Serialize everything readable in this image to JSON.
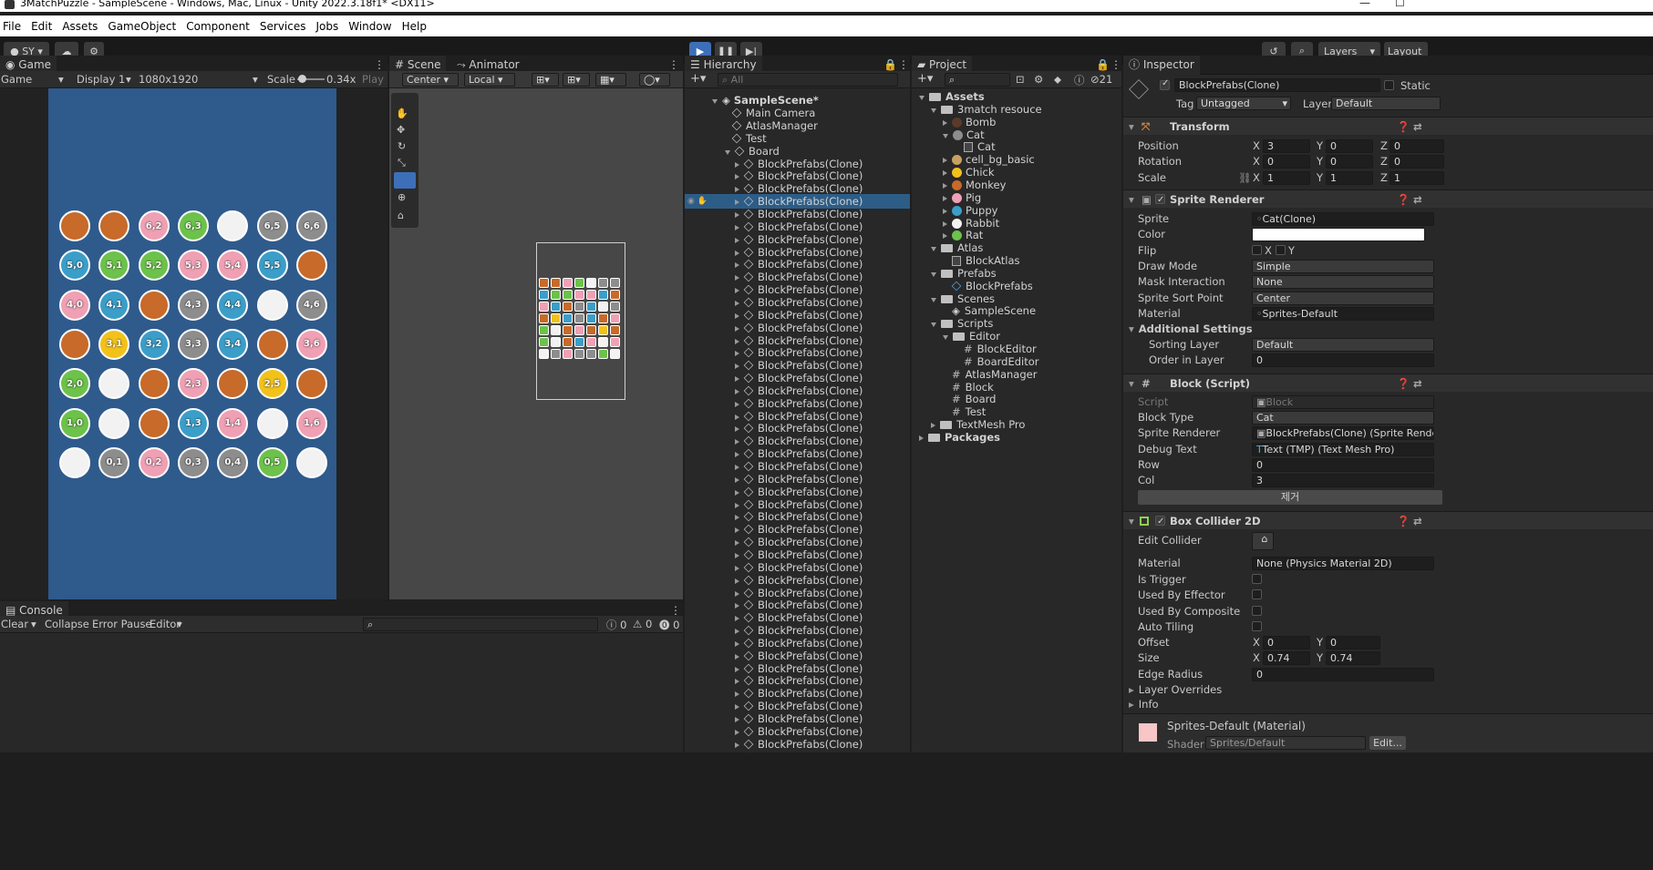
{
  "window": {
    "title": "3MatchPuzzle - SampleScene - Windows, Mac, Linux - Unity 2022.3.18f1* <DX11>"
  },
  "menu": [
    "File",
    "Edit",
    "Assets",
    "GameObject",
    "Component",
    "Services",
    "Jobs",
    "Window",
    "Help"
  ],
  "toolbar": {
    "account": "SY",
    "layers": "Layers",
    "layout": "Layout"
  },
  "game": {
    "tab": "Game",
    "mode": "Game",
    "display": "Display 1",
    "resolution": "1080x1920",
    "scale_label": "Scale",
    "scale_value": "0.34x",
    "play": "Play",
    "board": [
      [
        {
          "t": "monkey",
          "l": ""
        },
        {
          "t": "monkey",
          "l": ""
        },
        {
          "t": "pig",
          "l": "6,2"
        },
        {
          "t": "frog",
          "l": "6,3"
        },
        {
          "t": "rabbit",
          "l": ""
        },
        {
          "t": "cat",
          "l": "6,5"
        },
        {
          "t": "cat",
          "l": "6,6"
        }
      ],
      [
        {
          "t": "puppy",
          "l": "5,0"
        },
        {
          "t": "frog",
          "l": "5,1"
        },
        {
          "t": "frog",
          "l": "5,2"
        },
        {
          "t": "pig",
          "l": "5,3"
        },
        {
          "t": "pig",
          "l": "5,4"
        },
        {
          "t": "puppy",
          "l": "5,5"
        },
        {
          "t": "monkey",
          "l": ""
        }
      ],
      [
        {
          "t": "pig",
          "l": "4,0"
        },
        {
          "t": "puppy",
          "l": "4,1"
        },
        {
          "t": "monkey",
          "l": ""
        },
        {
          "t": "cat",
          "l": "4,3"
        },
        {
          "t": "puppy",
          "l": "4,4"
        },
        {
          "t": "rabbit",
          "l": ""
        },
        {
          "t": "cat",
          "l": "4,6"
        }
      ],
      [
        {
          "t": "monkey",
          "l": ""
        },
        {
          "t": "chick",
          "l": "3,1"
        },
        {
          "t": "puppy",
          "l": "3,2"
        },
        {
          "t": "cat",
          "l": "3,3"
        },
        {
          "t": "puppy",
          "l": "3,4"
        },
        {
          "t": "monkey",
          "l": ""
        },
        {
          "t": "pig",
          "l": "3,6"
        }
      ],
      [
        {
          "t": "frog",
          "l": "2,0"
        },
        {
          "t": "rabbit",
          "l": ""
        },
        {
          "t": "monkey",
          "l": ""
        },
        {
          "t": "pig",
          "l": "2,3"
        },
        {
          "t": "monkey",
          "l": ""
        },
        {
          "t": "chick",
          "l": "2,5"
        },
        {
          "t": "monkey",
          "l": ""
        }
      ],
      [
        {
          "t": "frog",
          "l": "1,0"
        },
        {
          "t": "rabbit",
          "l": ""
        },
        {
          "t": "monkey",
          "l": ""
        },
        {
          "t": "puppy",
          "l": "1,3"
        },
        {
          "t": "pig",
          "l": "1,4"
        },
        {
          "t": "rabbit",
          "l": ""
        },
        {
          "t": "pig",
          "l": "1,6"
        }
      ],
      [
        {
          "t": "rabbit",
          "l": ""
        },
        {
          "t": "cat",
          "l": "0,1"
        },
        {
          "t": "pig",
          "l": "0,2"
        },
        {
          "t": "cat",
          "l": "0,3"
        },
        {
          "t": "cat",
          "l": "0,4"
        },
        {
          "t": "frog",
          "l": "0,5"
        },
        {
          "t": "rabbit",
          "l": ""
        }
      ]
    ]
  },
  "tile_colors": {
    "monkey": "#c76a2a",
    "pig": "#f0a0b4",
    "frog": "#6cc24a",
    "rabbit": "#f2f2f2",
    "cat": "#8d8d8d",
    "puppy": "#3b9ec9",
    "chick": "#f2c21b"
  },
  "scene": {
    "tab": "Scene",
    "tab2": "Animator",
    "pivot": "Center",
    "space": "Local"
  },
  "hierarchy": {
    "tab": "Hierarchy",
    "search_placeholder": "All",
    "scene_name": "SampleScene*",
    "roots": [
      "Main Camera",
      "AtlasManager",
      "Test",
      "Board"
    ],
    "child": "BlockPrefabs(Clone)"
  },
  "project": {
    "tab": "Project",
    "count": "21",
    "tree": [
      {
        "d": 0,
        "n": "Assets",
        "k": "folder",
        "o": true
      },
      {
        "d": 1,
        "n": "3match resouce",
        "k": "folder",
        "o": true
      },
      {
        "d": 2,
        "n": "Bomb",
        "k": "bomb",
        "o": false
      },
      {
        "d": 2,
        "n": "Cat",
        "k": "cat",
        "o": true
      },
      {
        "d": 3,
        "n": "Cat",
        "k": "sprite"
      },
      {
        "d": 2,
        "n": "cell_bg_basic",
        "k": "cellbg",
        "o": false
      },
      {
        "d": 2,
        "n": "Chick",
        "k": "chick",
        "o": false
      },
      {
        "d": 2,
        "n": "Monkey",
        "k": "monkey",
        "o": false
      },
      {
        "d": 2,
        "n": "Pig",
        "k": "pig",
        "o": false
      },
      {
        "d": 2,
        "n": "Puppy",
        "k": "puppy",
        "o": false
      },
      {
        "d": 2,
        "n": "Rabbit",
        "k": "rabbit",
        "o": false
      },
      {
        "d": 2,
        "n": "Rat",
        "k": "frog",
        "o": false
      },
      {
        "d": 1,
        "n": "Atlas",
        "k": "folder",
        "o": true
      },
      {
        "d": 2,
        "n": "BlockAtlas",
        "k": "atlas"
      },
      {
        "d": 1,
        "n": "Prefabs",
        "k": "folder",
        "o": true
      },
      {
        "d": 2,
        "n": "BlockPrefabs",
        "k": "prefab"
      },
      {
        "d": 1,
        "n": "Scenes",
        "k": "folder",
        "o": true
      },
      {
        "d": 2,
        "n": "SampleScene",
        "k": "unity"
      },
      {
        "d": 1,
        "n": "Scripts",
        "k": "folder",
        "o": true
      },
      {
        "d": 2,
        "n": "Editor",
        "k": "folder",
        "o": true
      },
      {
        "d": 3,
        "n": "BlockEditor",
        "k": "script"
      },
      {
        "d": 3,
        "n": "BoardEditor",
        "k": "script"
      },
      {
        "d": 2,
        "n": "AtlasManager",
        "k": "script"
      },
      {
        "d": 2,
        "n": "Block",
        "k": "script"
      },
      {
        "d": 2,
        "n": "Board",
        "k": "script"
      },
      {
        "d": 2,
        "n": "Test",
        "k": "script"
      },
      {
        "d": 1,
        "n": "TextMesh Pro",
        "k": "folder",
        "o": false
      },
      {
        "d": 0,
        "n": "Packages",
        "k": "folder",
        "o": false
      }
    ]
  },
  "inspector": {
    "tab": "Inspector",
    "name": "BlockPrefabs(Clone)",
    "static": "Static",
    "tag_label": "Tag",
    "tag": "Untagged",
    "layer_label": "Layer",
    "layer": "Default",
    "transform": {
      "title": "Transform",
      "position": {
        "label": "Position",
        "x": "3",
        "y": "0",
        "z": "0"
      },
      "rotation": {
        "label": "Rotation",
        "x": "0",
        "y": "0",
        "z": "0"
      },
      "scale": {
        "label": "Scale",
        "x": "1",
        "y": "1",
        "z": "1"
      }
    },
    "sprite_renderer": {
      "title": "Sprite Renderer",
      "rows": [
        {
          "l": "Sprite",
          "v": "Cat(Clone)"
        },
        {
          "l": "Color",
          "v": ""
        },
        {
          "l": "Flip",
          "v": ""
        },
        {
          "l": "Draw Mode",
          "v": "Simple"
        },
        {
          "l": "Mask Interaction",
          "v": "None"
        },
        {
          "l": "Sprite Sort Point",
          "v": "Center"
        },
        {
          "l": "Material",
          "v": "Sprites-Default"
        }
      ],
      "flip_x": "X",
      "flip_y": "Y",
      "additional": "Additional Settings",
      "sorting_layer": {
        "l": "Sorting Layer",
        "v": "Default"
      },
      "order": {
        "l": "Order in Layer",
        "v": "0"
      }
    },
    "block": {
      "title": "Block (Script)",
      "rows": [
        {
          "l": "Script",
          "v": "Block"
        },
        {
          "l": "Block Type",
          "v": "Cat"
        },
        {
          "l": "Sprite Renderer",
          "v": "BlockPrefabs(Clone) (Sprite Rendere"
        },
        {
          "l": "Debug Text",
          "v": "Text (TMP) (Text Mesh Pro)"
        },
        {
          "l": "Row",
          "v": "0"
        },
        {
          "l": "Col",
          "v": "3"
        }
      ],
      "button": "제거"
    },
    "box_collider": {
      "title": "Box Collider 2D",
      "edit": "Edit Collider",
      "material": {
        "l": "Material",
        "v": "None (Physics Material 2D)"
      },
      "checks": [
        "Is Trigger",
        "Used By Effector",
        "Used By Composite",
        "Auto Tiling"
      ],
      "offset": {
        "l": "Offset",
        "x": "0",
        "y": "0"
      },
      "size": {
        "l": "Size",
        "x": "0.74",
        "y": "0.74"
      },
      "edge": {
        "l": "Edge Radius",
        "v": "0"
      },
      "overrides": "Layer Overrides",
      "info": "Info"
    },
    "material": {
      "name": "Sprites-Default (Material)",
      "shader_label": "Shader",
      "shader": "Sprites/Default",
      "edit": "Edit..."
    }
  },
  "console": {
    "tab": "Console",
    "clear": "Clear",
    "collapse": "Collapse",
    "error_pause": "Error Pause",
    "editor": "Editor",
    "logs": "0",
    "warnings": "0",
    "errors": "0"
  }
}
